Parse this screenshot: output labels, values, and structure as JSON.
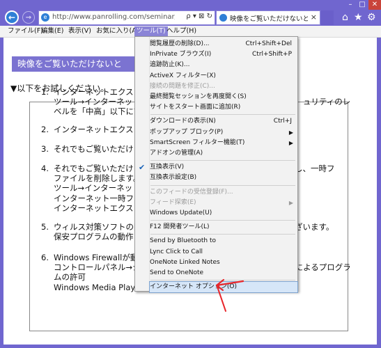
{
  "window_controls": {
    "minimize": "–",
    "maximize": "□",
    "close": "✕"
  },
  "toolbar": {
    "back": "←",
    "forward": "→",
    "home_icon": "⌂",
    "favorites_icon": "★",
    "tools_icon": "⚙"
  },
  "address_bar": {
    "url": "http://www.panrolling.com/seminar/notwatch.",
    "icons": "ρ ▾ ⊠ ↻"
  },
  "tab": {
    "title": "映像をご覧いただけないときの...",
    "close": "×"
  },
  "menu_bar": {
    "items": [
      "ファイル(F)",
      "編集(E)",
      "表示(V)",
      "お気に入り(A)",
      "ツール(T)",
      "ヘルプ(H)"
    ],
    "active_index": 4
  },
  "page": {
    "notice": "映像をご覧いただけないと",
    "intro": "▼以下をお試しください。",
    "steps": [
      {
        "num": "1.",
        "lines": [
          "インターネットエクスプ",
          "ツール→インターネット",
          "ベルを「中高」以下に設"
        ],
        "right": [
          "",
          "ュリティのレ",
          ""
        ]
      },
      {
        "num": "2.",
        "lines": [
          "インターネットエクスプ"
        ],
        "right": [
          ""
        ]
      },
      {
        "num": "3.",
        "lines": [
          "それでもご覧いただけ"
        ],
        "right": [
          ""
        ]
      },
      {
        "num": "4.",
        "lines": [
          "それでもご覧いただけ",
          "ファイルを削除します。",
          "ツール→インターネット",
          "インターネット一時ファ",
          "インターネットエクスプ"
        ],
        "right": [
          "し、一時フ",
          "",
          "",
          "",
          ""
        ]
      },
      {
        "num": "5.",
        "lines": [
          "ウィルス対策ソフトの防",
          "保安プログラムの動作"
        ],
        "right": [
          "ざいます。",
          ""
        ]
      },
      {
        "num": "6.",
        "lines": [
          "Windows Firewallが動",
          "コントロールパネル→システムとセキュリティ→Windows Firewallによるプログラ",
          "ムの許可",
          "Windows Media Playerを選択し許可を行ってください。"
        ],
        "right": [
          "",
          "",
          "",
          ""
        ]
      }
    ]
  },
  "tools_menu": {
    "groups": [
      [
        {
          "label": "閲覧履歴の削除(D)...",
          "shortcut": "Ctrl+Shift+Del"
        },
        {
          "label": "InPrivate ブラウズ(I)",
          "shortcut": "Ctrl+Shift+P"
        },
        {
          "label": "追跡防止(K)...",
          "shortcut": ""
        },
        {
          "label": "ActiveX フィルター(X)",
          "shortcut": ""
        },
        {
          "label": "接続の問題を修正(C)...",
          "shortcut": "",
          "disabled": true
        },
        {
          "label": "最終閲覧セッションを再度開く(S)",
          "shortcut": ""
        },
        {
          "label": "サイトをスタート画面に追加(R)",
          "shortcut": ""
        }
      ],
      [
        {
          "label": "ダウンロードの表示(N)",
          "shortcut": "Ctrl+J"
        },
        {
          "label": "ポップアップ ブロック(P)",
          "shortcut": "",
          "submenu": true
        },
        {
          "label": "SmartScreen フィルター機能(T)",
          "shortcut": "",
          "submenu": true
        },
        {
          "label": "アドオンの管理(A)",
          "shortcut": ""
        }
      ],
      [
        {
          "label": "互換表示(V)",
          "shortcut": "",
          "checked": true
        },
        {
          "label": "互換表示設定(B)",
          "shortcut": ""
        }
      ],
      [
        {
          "label": "このフィードの受信登録(F)...",
          "shortcut": "",
          "disabled": true
        },
        {
          "label": "フィード探索(E)",
          "shortcut": "",
          "disabled": true,
          "submenu": true
        },
        {
          "label": "Windows Update(U)",
          "shortcut": ""
        }
      ],
      [
        {
          "label": "F12 開発者ツール(L)",
          "shortcut": ""
        }
      ],
      [
        {
          "label": "Send by Bluetooth to",
          "shortcut": ""
        },
        {
          "label": "Lync Click to Call",
          "shortcut": ""
        },
        {
          "label": "OneNote Linked Notes",
          "shortcut": ""
        },
        {
          "label": "Send to OneNote",
          "shortcut": ""
        }
      ],
      [
        {
          "label": "インターネット オプション(O)",
          "shortcut": "",
          "highlighted": true
        }
      ]
    ]
  },
  "colors": {
    "chrome": "#7066cf",
    "accent": "#2e7fd6",
    "annotation": "#e8262b",
    "highlight": "#d6e6f8"
  }
}
